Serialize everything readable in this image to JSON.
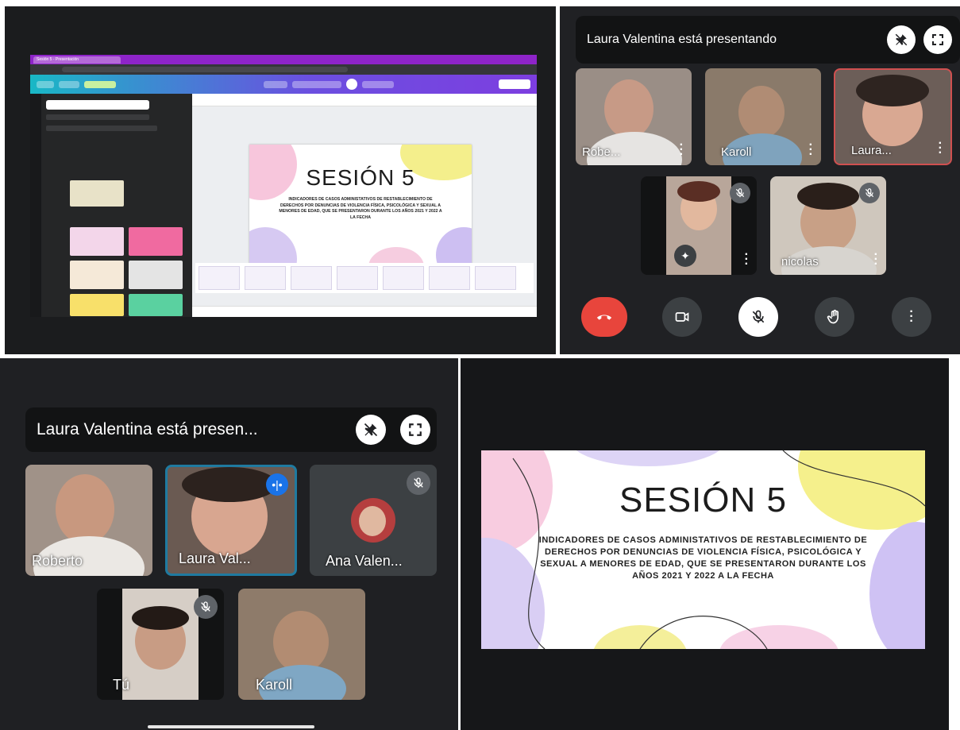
{
  "canva": {
    "tab_title": "Sesión 5 - Presentación",
    "slide_title": "SESIÓN 5",
    "slide_body": "INDICADORES DE CASOS ADMINISTATIVOS DE RESTABLECIMIENTO DE DERECHOS POR DENUNCIAS DE VIOLENCIA FÍSICA, PSICOLÓGICA Y SEXUAL A MENORES DE EDAD, QUE SE PRESENTARON DURANTE LOS AÑOS 2021 Y 2022  A LA FECHA"
  },
  "meet_tablet": {
    "presenting_text": "Laura Valentina está presentando",
    "participants": [
      {
        "name": "Robe..."
      },
      {
        "name": "Karoll"
      },
      {
        "name": "Laura..."
      },
      {
        "name": ""
      },
      {
        "name": "nicolas"
      }
    ]
  },
  "meet_phone": {
    "presenting_text": "Laura Valentina está presen...",
    "participants": [
      {
        "name": "Roberto"
      },
      {
        "name": "Laura Val..."
      },
      {
        "name": "Ana Valen..."
      },
      {
        "name": "Tú"
      },
      {
        "name": "Karoll"
      }
    ]
  },
  "presented_slide": {
    "title": "SESIÓN 5",
    "body": "INDICADORES DE CASOS ADMINISTATIVOS DE RESTABLECIMIENTO DE DERECHOS POR DENUNCIAS DE VIOLENCIA FÍSICA, PSICOLÓGICA Y SEXUAL A MENORES DE EDAD, QUE SE PRESENTARON DURANTE LOS AÑOS 2021 Y 2022  A LA FECHA"
  },
  "colors": {
    "end_call": "#e8453c",
    "active_speaker": "#8ab4f8",
    "canva_tabbar": "#8e24c9"
  }
}
